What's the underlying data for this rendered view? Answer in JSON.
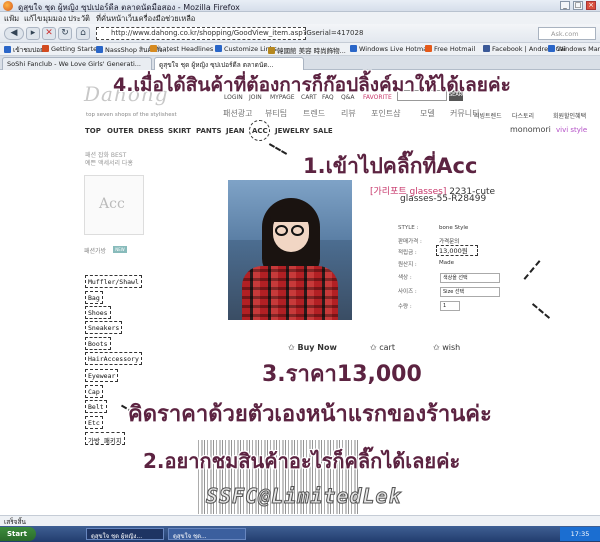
{
  "window": {
    "title": "ดูสุขใจ ชุด ผู้หญิง ซุปเปอร์ดีล ตลาดนัดมือสอง - Mozilla Firefox"
  },
  "menu": {
    "items": [
      "แฟ้ม",
      "แก้ไข",
      "มุมมอง",
      "ประวัติ",
      "ที่คั่นหน้าเว็บ",
      "เครื่องมือ",
      "ช่วยเหลือ"
    ]
  },
  "nav": {
    "url": "http://www.dahong.co.kr/shopping/GoodView_item.asp?Gserial=417028",
    "search_placeholder": "Ask.com"
  },
  "bookmarks": [
    {
      "label": "เข้าชมบ่อย",
      "color": "#2a66c8"
    },
    {
      "label": "Getting Started",
      "color": "#d24b1f"
    },
    {
      "label": "NassShop สินค้าสั่ง...",
      "color": "#2a66c8"
    },
    {
      "label": "Latest Headlines",
      "color": "#d68a1f"
    },
    {
      "label": "Customize Links",
      "color": "#2a66c8"
    },
    {
      "label": "韓國館 美容 時尚飾物...",
      "color": "#b6881f"
    },
    {
      "label": "Windows Live Hotmail",
      "color": "#2a66c8"
    },
    {
      "label": "Free Hotmail",
      "color": "#e55a1a"
    },
    {
      "label": "Facebook | Andrew Cai",
      "color": "#3b5998"
    },
    {
      "label": "Windows Marketplace",
      "color": "#2a66c8"
    }
  ],
  "tabs": [
    {
      "label": "SoShi Fanclub - We Love Girls' Generati..."
    },
    {
      "label": "ดูสุขใจ ชุด ผู้หญิง ซุปเปอร์ดีล ตลาดนัด..."
    }
  ],
  "site": {
    "logo": "Dahong",
    "tagline": "top seven shops of the stylishest",
    "top_links": [
      "LOGIN",
      "JOIN",
      "MYPAGE",
      "CART",
      "FAQ",
      "Q&A",
      "FAVORITE"
    ],
    "search_btn": "SEARCH",
    "menu_kor": [
      "패션광고",
      "뷰티팁",
      "트렌드",
      "리뷰",
      "포인트샵",
      "모델",
      "커뮤니티"
    ],
    "categories": [
      "TOP",
      "OUTER",
      "DRESS",
      "SKIRT",
      "PANTS",
      "JEAN",
      "ACC",
      "JEWELRY",
      "SALE"
    ],
    "right_links": [
      "리빙트렌드",
      "다스토리",
      "회원할인혜택"
    ],
    "brand_right1": "monomori",
    "brand_right2": "vivi style",
    "left_sub": [
      "패션 잡화 BEST",
      "예쁜 액세서리 다홍"
    ],
    "acc_label": "Acc",
    "new_label": "패션가방",
    "new_badge": "NEW",
    "left_cats": [
      "Muffler/Shawl",
      "Bag",
      "Shoes",
      "Sneakers",
      "Boots",
      "HairAccessory",
      "Eyewear",
      "Cap",
      "Belt",
      "Etc",
      "가방 패키지"
    ]
  },
  "product": {
    "title_cat": "[가리포트 glasses]",
    "title_code": "2231-cute",
    "title_line2": "glasses-55-R28499",
    "specs": [
      {
        "label": "STYLE :",
        "value": "bone Style"
      },
      {
        "label": "판매가격 :",
        "value": "가격문의"
      },
      {
        "label": "적립금 :",
        "value": ""
      },
      {
        "label": "원산지 :",
        "value": "Made"
      },
      {
        "label": "색상 :",
        "value": ""
      },
      {
        "label": "사이즈 :",
        "value": ""
      },
      {
        "label": "수량 :",
        "value": ""
      }
    ],
    "price": "13,000원",
    "color_option": "색상을 선택",
    "size_option": "Size 선택",
    "qty": "1",
    "buy_now": "Buy Now",
    "cart": "cart",
    "wish": "wish"
  },
  "overlay": {
    "step4": "4.เมื่อได้สินค้าที่ต้องการก็ก๊อปลิ้งค์มาให้ได้เลยค่ะ",
    "step1": "1.เข้าไปคลิ๊กที่Acc",
    "step3": "3.ราคา13,000",
    "note": "คิดราคาด้วยตัวเองหน้าแรกของร้านค่ะ",
    "step2": "2.อยากชมสินค้าอะไรก็คลิ๊กได้เลยค่ะ",
    "watermark": "SSFC@LimitedLek"
  },
  "status": {
    "text": "เสร็จสิ้น"
  },
  "taskbar": {
    "start": "Start",
    "tasks": [
      {
        "label": "ดูสุขใจ ชุด ผู้หญิง..."
      },
      {
        "label": "ดูสุขใจ ชุด..."
      }
    ],
    "clock": "17:35"
  }
}
